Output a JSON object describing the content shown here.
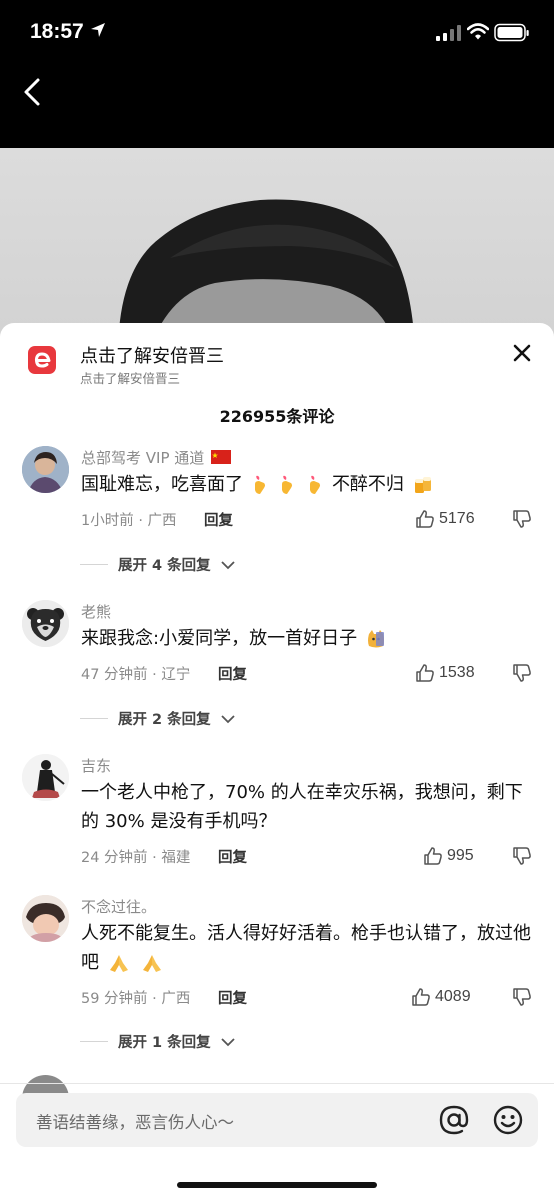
{
  "status_bar": {
    "time": "18:57"
  },
  "sheet": {
    "title": "点击了解安倍晋三",
    "subtitle": "点击了解安倍晋三",
    "comment_count": "226955条评论"
  },
  "comments": [
    {
      "user": "总部驾考 VIP 通道",
      "text_a": "国耻难忘，吃喜面了",
      "text_b": "不醉不归",
      "meta": "1小时前 · 广西",
      "reply_label": "回复",
      "likes": "5176",
      "expand_label": "展开 4 条回复"
    },
    {
      "user": "老熊",
      "text": "来跟我念:小爱同学，放一首好日子",
      "meta": "47 分钟前 · 辽宁",
      "reply_label": "回复",
      "likes": "1538",
      "expand_label": "展开 2 条回复"
    },
    {
      "user": "吉东",
      "text": "一个老人中枪了，70% 的人在幸灾乐祸，我想问，剩下的 30% 是没有手机吗？",
      "meta": "24 分钟前 · 福建",
      "reply_label": "回复",
      "likes": "995"
    },
    {
      "user": "不念过往。",
      "text": "人死不能复生。活人得好好活着。枪手也认错了，放过他吧",
      "meta": "59 分钟前 · 广西",
      "reply_label": "回复",
      "likes": "4089",
      "expand_label": "展开 1 条回复"
    }
  ],
  "input": {
    "placeholder": "善语结善缘，恶言伤人心～"
  },
  "icons": {
    "back": "chevron-left-icon",
    "close": "close-icon",
    "like": "thumbs-up-icon",
    "dislike": "thumbs-down-icon",
    "expand": "chevron-down-icon",
    "mention": "at-icon",
    "emoji": "smiley-icon"
  },
  "colors": {
    "brand": "#e8383d",
    "text": "#111111",
    "muted": "#8a8a8a"
  }
}
